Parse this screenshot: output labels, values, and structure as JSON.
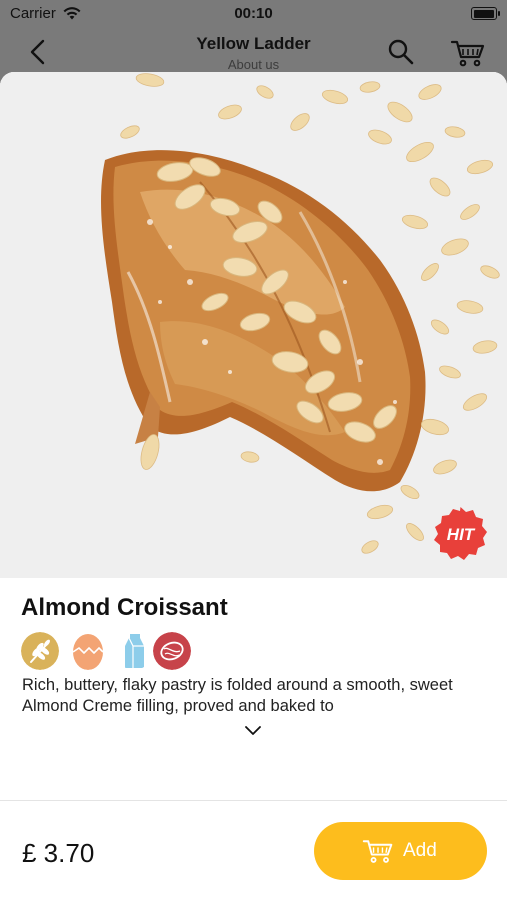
{
  "status_bar": {
    "carrier": "Carrier",
    "time": "00:10",
    "battery_level": 1.0
  },
  "nav": {
    "title": "Yellow Ladder",
    "subtitle": "About us",
    "back_icon": "chevron-left-icon",
    "search_icon": "search-icon",
    "cart_icon": "cart-icon"
  },
  "product": {
    "image_alt": "almond-croissant-photo",
    "badge": "HIT",
    "name": "Almond Croissant",
    "allergens": [
      {
        "icon": "gluten-icon",
        "color": "#d9b25a"
      },
      {
        "icon": "egg-icon",
        "color": "#f3a474"
      },
      {
        "icon": "milk-icon",
        "color": "#8dcdea"
      },
      {
        "icon": "nuts-icon",
        "color": "#c7434a"
      }
    ],
    "description": "Rich, buttery, flaky pastry is folded around a smooth, sweet Almond Creme filling, proved and baked to",
    "expand_icon": "chevron-down-icon",
    "price": "£ 3.70"
  },
  "actions": {
    "add_label": "Add",
    "add_icon": "cart-icon"
  },
  "colors": {
    "accent": "#fdbd1d",
    "badge": "#e8403a",
    "overlay": "#7a7a7a"
  }
}
